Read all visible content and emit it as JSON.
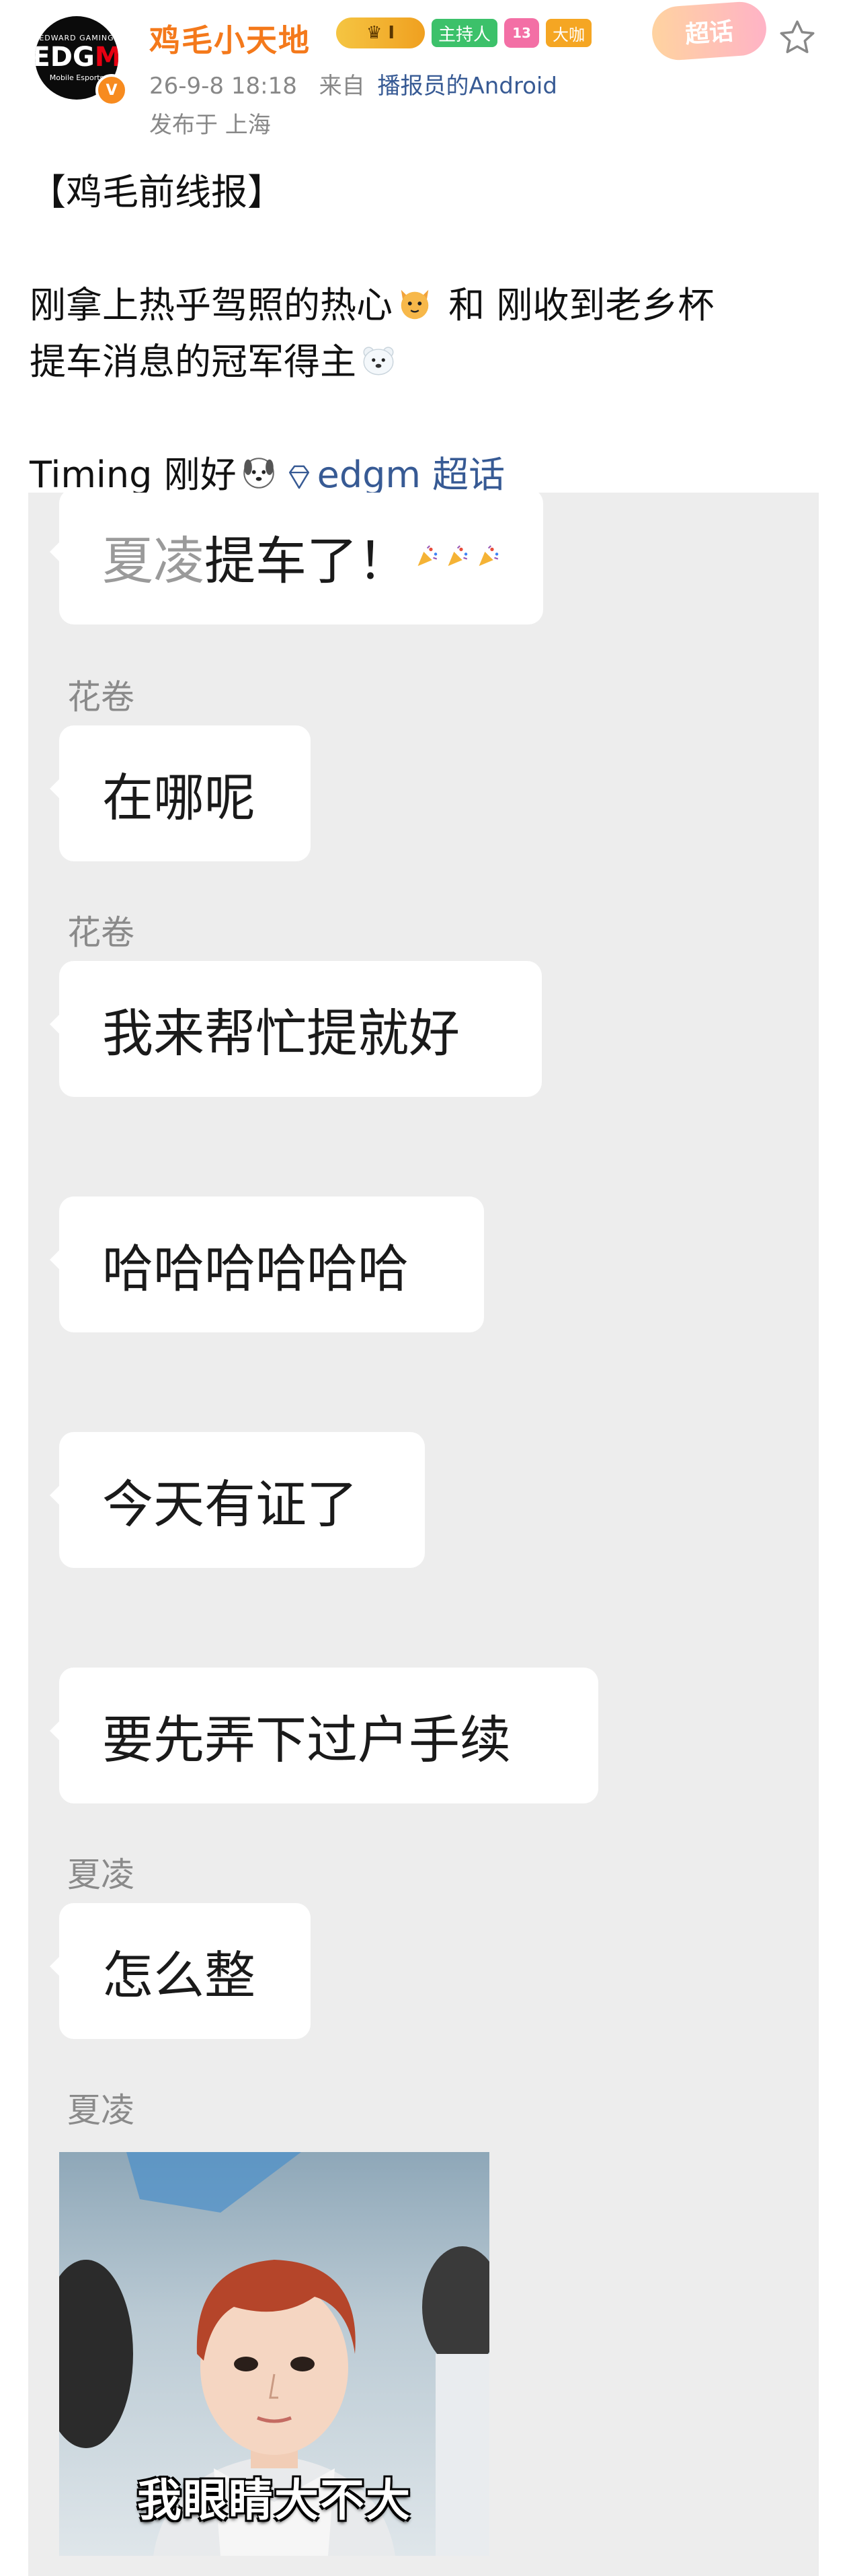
{
  "header": {
    "avatar_logo_top": "EDWARD GAMING",
    "avatar_logo_main_a": "EDG",
    "avatar_logo_main_b": "M",
    "avatar_logo_sub": "Mobile Esports",
    "verified_mark": "V",
    "username": "鸡毛小天地",
    "crown_badge": "I",
    "host_badge": "主持人",
    "level_badge": "13",
    "big_badge": "大咖",
    "supertopic_badge": "超话",
    "timestamp": "26-9-8 18:18",
    "source_prefix": "来自",
    "source_device": "播报员的Android",
    "location": "发布于 上海",
    "accent_color": "#f4791b",
    "link_color": "#375a94"
  },
  "post": {
    "line1": "【鸡毛前线报】",
    "line2a": "刚拿上热乎驾照的热心",
    "line2b": " 和 刚收到老乡杯",
    "line3": "提车消息的冠军得主",
    "line4a": "Timing 刚好",
    "topic": "edgm 超话",
    "icons": [
      "cat-emoji-icon",
      "polar-bear-emoji-icon",
      "dog-emoji-icon",
      "diamond-icon"
    ]
  },
  "chat": {
    "messages": [
      {
        "sender": "",
        "text_ghost": "夏凌",
        "text": "提车了！",
        "emoji": "party-popper-icon"
      },
      {
        "sender": "花卷",
        "text": "在哪呢"
      },
      {
        "sender": "花卷",
        "text": "我来帮忙提就好"
      },
      {
        "sender": "",
        "text": "哈哈哈哈哈哈"
      },
      {
        "sender": "",
        "text": "今天有证了"
      },
      {
        "sender": "",
        "text": "要先弄下过户手续"
      },
      {
        "sender": "夏凌",
        "text": "怎么整"
      },
      {
        "sender": "夏凌",
        "photo_caption": "我眼睛大不大"
      }
    ]
  }
}
